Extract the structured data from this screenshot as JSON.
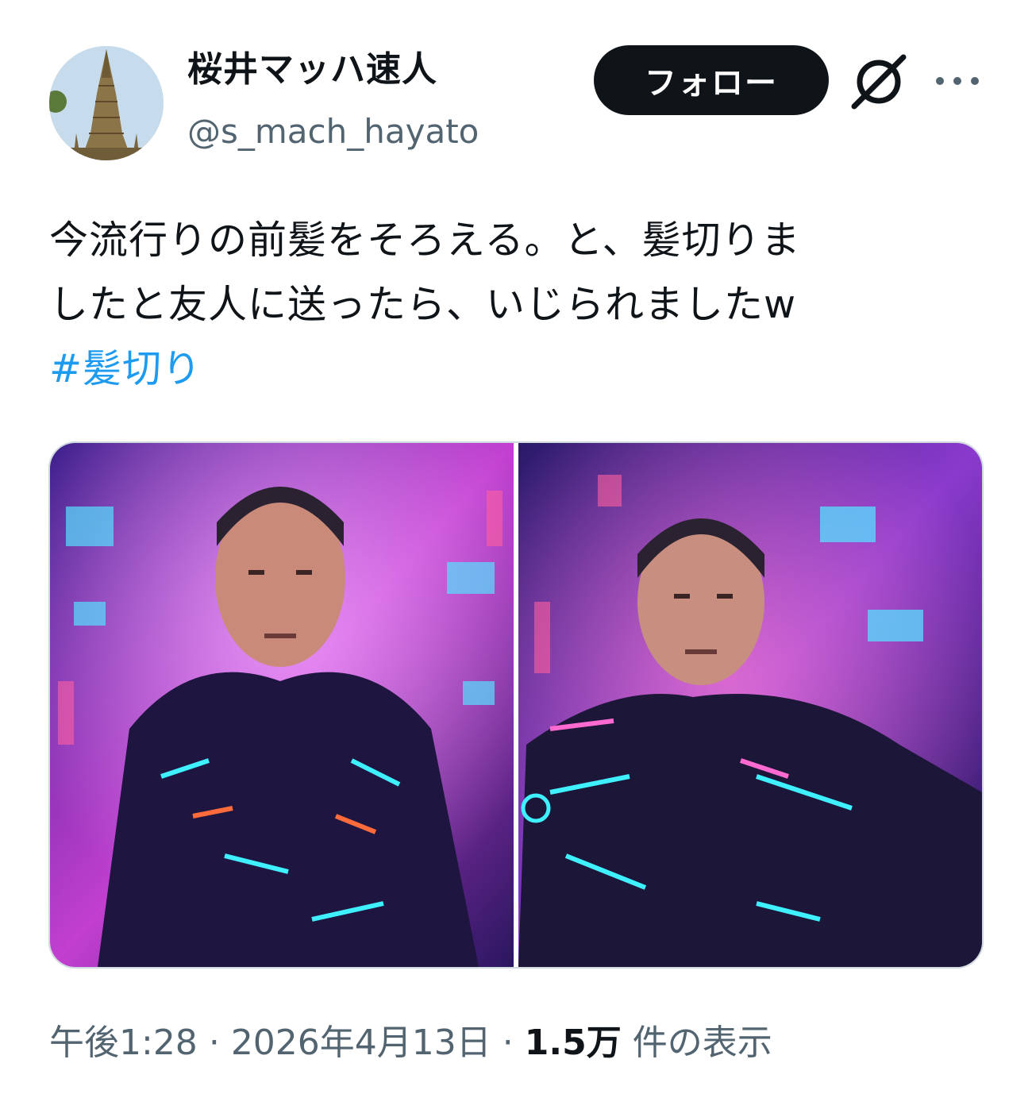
{
  "author": {
    "display_name": "桜井マッハ速人",
    "handle": "@s_mach_hayato",
    "avatar_icon": "temple-photo-avatar"
  },
  "actions": {
    "follow_label": "フォロー",
    "grok_icon": "grok-icon",
    "more_icon": "more-dots-icon"
  },
  "tweet": {
    "lines": [
      "今流行りの前髪をそろえる。と、髪切りま",
      "したと友人に送ったら、いじられましたw"
    ],
    "hashtag": "#髪切り"
  },
  "media": [
    {
      "alt_icon": "cyberpunk-portrait-image-1"
    },
    {
      "alt_icon": "cyberpunk-portrait-image-2"
    }
  ],
  "meta": {
    "time": "午後1:28",
    "date": "2026年4月13日",
    "separator": "·",
    "views_count": "1.5万",
    "views_label": "件の表示"
  },
  "colors": {
    "text": "#0f1419",
    "secondary": "#536471",
    "link": "#1d9bf0",
    "follow_bg": "#0f1419"
  }
}
